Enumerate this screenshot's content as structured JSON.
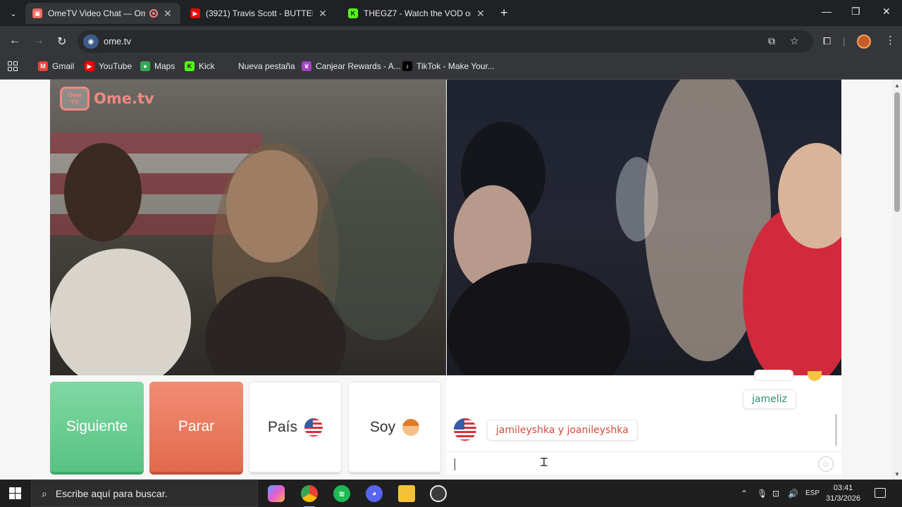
{
  "browser": {
    "tabs": [
      {
        "title": "OmeTV Video Chat — Ome",
        "active": true,
        "recording": true
      },
      {
        "title": "(3921) Travis Scott - BUTTERFLY",
        "active": false
      },
      {
        "title": "THEGZ7 - Watch the VOD on Ki",
        "active": false
      }
    ],
    "url": "ome.tv",
    "bookmarks": [
      "Gmail",
      "YouTube",
      "Maps",
      "Kick",
      "Nueva pestaña",
      "Canjear Rewards - A...",
      "TikTok - Make Your..."
    ],
    "window_controls": {
      "minimize": "—",
      "maximize": "❐",
      "close": "✕"
    }
  },
  "page": {
    "logo": {
      "badge_top": "Ome",
      "badge_bottom": "TV",
      "text": "Ome.tv"
    },
    "buttons": {
      "next": "Siguiente",
      "stop": "Parar",
      "country": "País",
      "gender": "Soy"
    },
    "chat": {
      "messages": [
        {
          "from": "me",
          "text": "jameliz"
        },
        {
          "from": "stranger",
          "country_flag": "us-flag-icon",
          "text": "jamileyshka y joanileyshka"
        }
      ],
      "input_value": ""
    }
  },
  "taskbar": {
    "search_placeholder": "Escribe aquí para buscar.",
    "language": "ESP",
    "time": "03:41",
    "date": "31/3/2026"
  },
  "colors": {
    "next_button": "#58c283",
    "stop_button": "#e26a4e",
    "logo": "#ef8a80",
    "message_me": "#2f8f6a",
    "message_stranger": "#d04b3a"
  }
}
